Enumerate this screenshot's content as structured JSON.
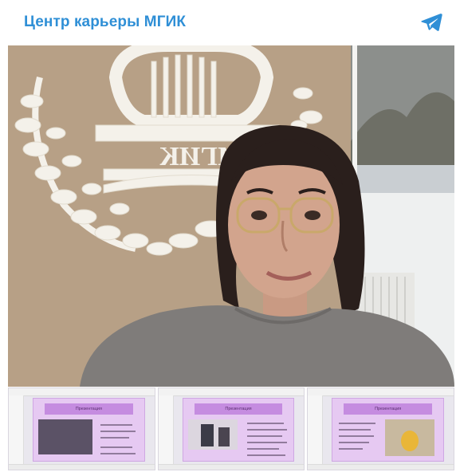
{
  "header": {
    "title": "Центр карьеры МГИК",
    "icon": "telegram-icon",
    "accent_color": "#2f8fd6"
  },
  "photo": {
    "emblem_letters": "МГИК"
  },
  "thumbnails": [
    {
      "title": "Презентация"
    },
    {
      "title": "Презентация"
    },
    {
      "title": "Презентация"
    }
  ]
}
